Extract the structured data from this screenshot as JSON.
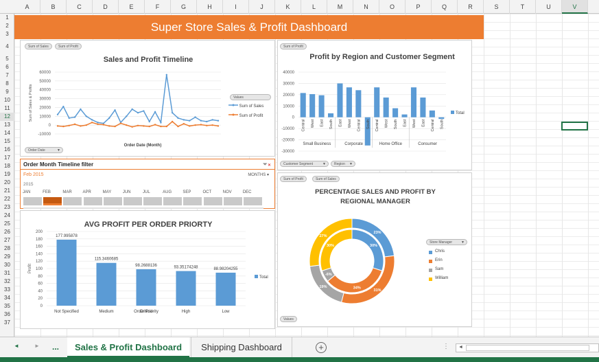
{
  "columns": [
    "A",
    "B",
    "C",
    "D",
    "E",
    "F",
    "G",
    "H",
    "I",
    "J",
    "K",
    "L",
    "M",
    "N",
    "O",
    "P",
    "Q",
    "R",
    "S",
    "T",
    "U",
    "V"
  ],
  "rows": [
    "1",
    "2",
    "3",
    "4",
    "5",
    "6",
    "7",
    "8",
    "9",
    "10",
    "11",
    "12",
    "13",
    "14",
    "15",
    "16",
    "17",
    "18",
    "19",
    "20",
    "21",
    "22",
    "23",
    "24",
    "25",
    "26",
    "27",
    "28",
    "29",
    "30",
    "31",
    "32",
    "33",
    "34",
    "35",
    "36",
    "37"
  ],
  "selected_cell": {
    "col": "V",
    "row": "12"
  },
  "dashboard": {
    "title": "Super Store Sales & Profit Dashboard"
  },
  "timeline_chart": {
    "pills": [
      "Sum of Sales",
      "Sum of Profit"
    ],
    "filter_pill": "Order Date",
    "title": "Sales and Profit Timeline",
    "ylabel": "Sum of Sales & Profits",
    "xlabel": "Order Date (Month)",
    "legend_title": "Values",
    "series_names": [
      "Sum of Sales",
      "Sum of Profit"
    ]
  },
  "region_chart": {
    "pill": "Sum of Profit",
    "title": "Profit by Region and Customer Segment",
    "filters": [
      "Customer Segment",
      "Region"
    ],
    "legend": "Total",
    "segments": [
      "Small Business",
      "Corporate",
      "Home Office",
      "Consumer"
    ],
    "regions": [
      "Central",
      "West",
      "East",
      "South"
    ]
  },
  "timeline_filter": {
    "title": "Order Month Timeline filter",
    "selection": "Feb 2015",
    "level": "MONTHS",
    "year": "2015",
    "months": [
      "JAN",
      "FEB",
      "MAR",
      "APR",
      "MAY",
      "JUN",
      "JUL",
      "AUG",
      "SEP",
      "OCT",
      "NOV",
      "DEC"
    ],
    "selected_index": 1
  },
  "priority_chart": {
    "title": "AVG PROFIT PER ORDER PRIORTY",
    "ylabel": "Profit",
    "legend": "Total",
    "y_ticks": [
      "0",
      "20",
      "40",
      "60",
      "80",
      "100",
      "120",
      "140",
      "160",
      "180",
      "200"
    ]
  },
  "donut_chart": {
    "pills": [
      "Sum of Profit",
      "Sum of Sales"
    ],
    "title_line1": "PERCENTAGE SALES AND PROFIT BY",
    "title_line2": "REGIONAL MANAGER",
    "filter": "Store Manager",
    "managers": [
      "Chris",
      "Erin",
      "Sam",
      "William"
    ],
    "colors": [
      "#5b9bd5",
      "#ed7d31",
      "#a5a5a5",
      "#ffc000"
    ],
    "outer_labels": [
      "23%",
      "31%",
      "19%",
      "27%"
    ],
    "inner_labels": [
      "30%",
      "34%",
      "-6%",
      "30%"
    ],
    "values_pill": "Values"
  },
  "chart_data": [
    {
      "type": "line",
      "title": "Sales and Profit Timeline",
      "xlabel": "Order Date (Month)",
      "ylabel": "Sum of Sales & Profits",
      "ylim": [
        -10000,
        60000
      ],
      "y_ticks": [
        60000,
        50000,
        40000,
        30000,
        20000,
        10000,
        0,
        -10000
      ],
      "series": [
        {
          "name": "Sum of Sales",
          "values": [
            12000,
            21000,
            8000,
            9000,
            18000,
            10000,
            6000,
            3000,
            2000,
            8000,
            17000,
            3000,
            10000,
            18000,
            14000,
            16000,
            4000,
            15000,
            3000,
            57000,
            14000,
            8000,
            6000,
            5000,
            9000,
            5000,
            4000,
            6000,
            5000
          ]
        },
        {
          "name": "Sum of Profit",
          "values": [
            -1000,
            -1500,
            -500,
            1000,
            -1000,
            0,
            3000,
            1000,
            500,
            -1000,
            -1500,
            2000,
            0,
            -2000,
            -500,
            -1000,
            -1500,
            500,
            -1500,
            -1500,
            4000,
            -1500,
            1500,
            -1000,
            0,
            500,
            -500,
            0,
            -1000
          ]
        }
      ]
    },
    {
      "type": "bar",
      "title": "Profit by Region and Customer Segment",
      "ylim": [
        -30000,
        40000
      ],
      "y_ticks": [
        40000,
        30000,
        20000,
        10000,
        0,
        -10000,
        -20000,
        -30000
      ],
      "categories": [
        "Small Business-Central",
        "Small Business-West",
        "Small Business-East",
        "Small Business-South",
        "Corporate-East",
        "Corporate-West",
        "Corporate-Central",
        "Corporate-South",
        "Home Office-Central",
        "Home Office-West",
        "Home Office-South",
        "Home Office-East",
        "Consumer-West",
        "Consumer-East",
        "Consumer-Central",
        "Consumer-South"
      ],
      "series": [
        {
          "name": "Total",
          "values": [
            21500,
            20500,
            19500,
            3500,
            30000,
            26500,
            24000,
            -25000,
            26500,
            17500,
            8000,
            2500,
            26500,
            17500,
            6000,
            -1500
          ]
        }
      ]
    },
    {
      "type": "bar",
      "title": "AVG PROFIT PER ORDER PRIORTY",
      "ylabel": "Profit",
      "ylim": [
        0,
        200
      ],
      "categories": [
        "Not Specified",
        "Medium",
        "Order Priority",
        "Critical",
        "High",
        "Low"
      ],
      "series": [
        {
          "name": "Total",
          "values": [
            177.995878,
            115.3460685,
            98.2688136,
            93.35174248,
            88.98204255
          ]
        }
      ],
      "data_labels": [
        "177.995878",
        "115.3460685",
        "98.2688136",
        "93.35174248",
        "88.98204255"
      ],
      "x_labels": [
        [
          "Not Specified"
        ],
        [
          "Medium"
        ],
        [
          "Order Priority",
          "Critical"
        ],
        [
          "High"
        ],
        [
          "Low"
        ]
      ]
    },
    {
      "type": "pie",
      "title": "PERCENTAGE SALES AND PROFIT BY REGIONAL MANAGER",
      "categories": [
        "Chris",
        "Erin",
        "Sam",
        "William"
      ],
      "series": [
        {
          "name": "Sum of Sales",
          "values": [
            23,
            31,
            19,
            27
          ]
        },
        {
          "name": "Sum of Profit",
          "values": [
            30,
            34,
            -6,
            30
          ]
        }
      ]
    }
  ],
  "sheet_tabs": {
    "nav_prev": "◄",
    "nav_next": "►",
    "more": "...",
    "tabs": [
      "Sales & Profit Dashboard",
      "Shipping Dashboard"
    ],
    "active": 0,
    "add": "+"
  }
}
